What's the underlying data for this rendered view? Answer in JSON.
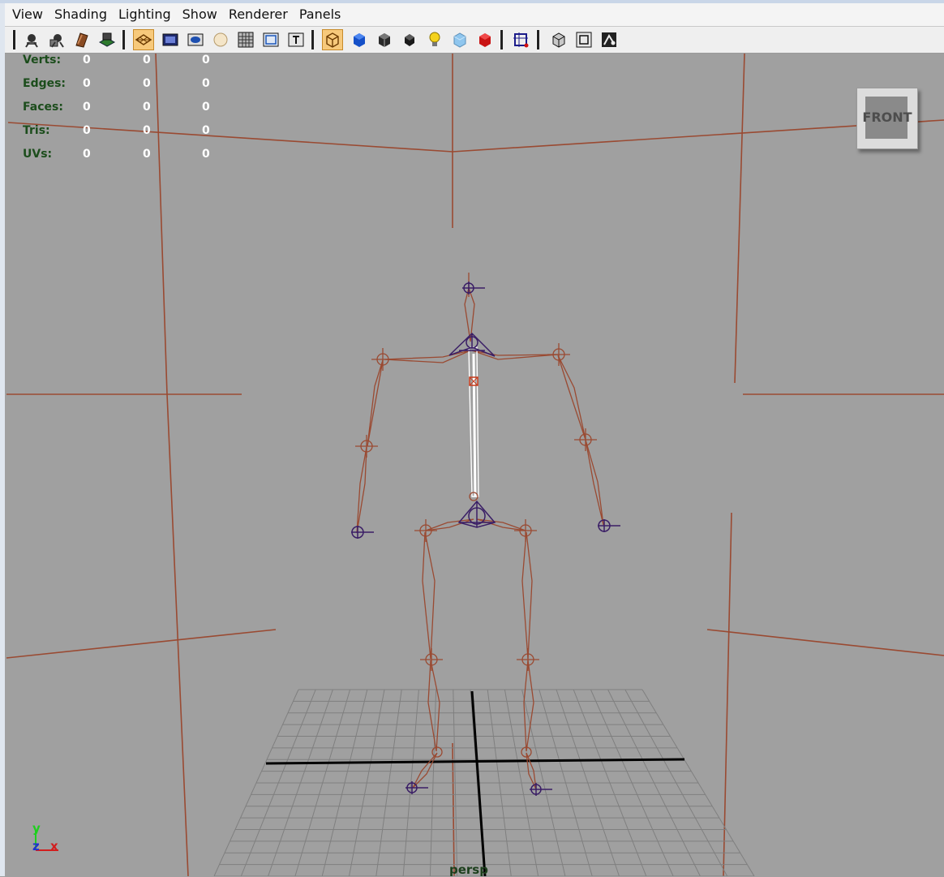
{
  "menu": [
    "View",
    "Shading",
    "Lighting",
    "Show",
    "Renderer",
    "Panels"
  ],
  "toolbar_icons": [
    "camera-select-icon",
    "camera-attributes-icon",
    "bookmark-icon",
    "image-plane-icon",
    "grid-toggle-icon",
    "film-gate-icon",
    "resolution-gate-icon",
    "gate-mask-icon",
    "field-chart-icon",
    "safe-action-icon",
    "safe-title-icon",
    "wireframe-icon",
    "smooth-shade-icon",
    "textured-icon",
    "default-material-icon",
    "use-all-lights-icon",
    "xray-icon",
    "xray-joints-icon",
    "isolate-select-icon",
    "wireframe-on-shaded-icon",
    "frame-all-icon",
    "select-camera-icon"
  ],
  "hud": {
    "rows": [
      {
        "label": "Verts:",
        "values": [
          "0",
          "0",
          "0"
        ]
      },
      {
        "label": "Edges:",
        "values": [
          "0",
          "0",
          "0"
        ]
      },
      {
        "label": "Faces:",
        "values": [
          "0",
          "0",
          "0"
        ]
      },
      {
        "label": "Tris:",
        "values": [
          "0",
          "0",
          "0"
        ]
      },
      {
        "label": "UVs:",
        "values": [
          "0",
          "0",
          "0"
        ]
      }
    ]
  },
  "viewcube": {
    "face_label": "FRONT"
  },
  "camera_label": "persp",
  "axis_labels": {
    "y": "y",
    "z": "z",
    "x": "x"
  },
  "colors": {
    "viewport_bg": "#a0a0a0",
    "joint_wire": "#9a4a32",
    "joint_selected": "#3a1e66",
    "grid": "#7f7f7f",
    "hud_label": "#1c4d1c",
    "axis_x": "#d21e1e",
    "axis_y": "#1ecf1e",
    "axis_z": "#2030d0"
  }
}
